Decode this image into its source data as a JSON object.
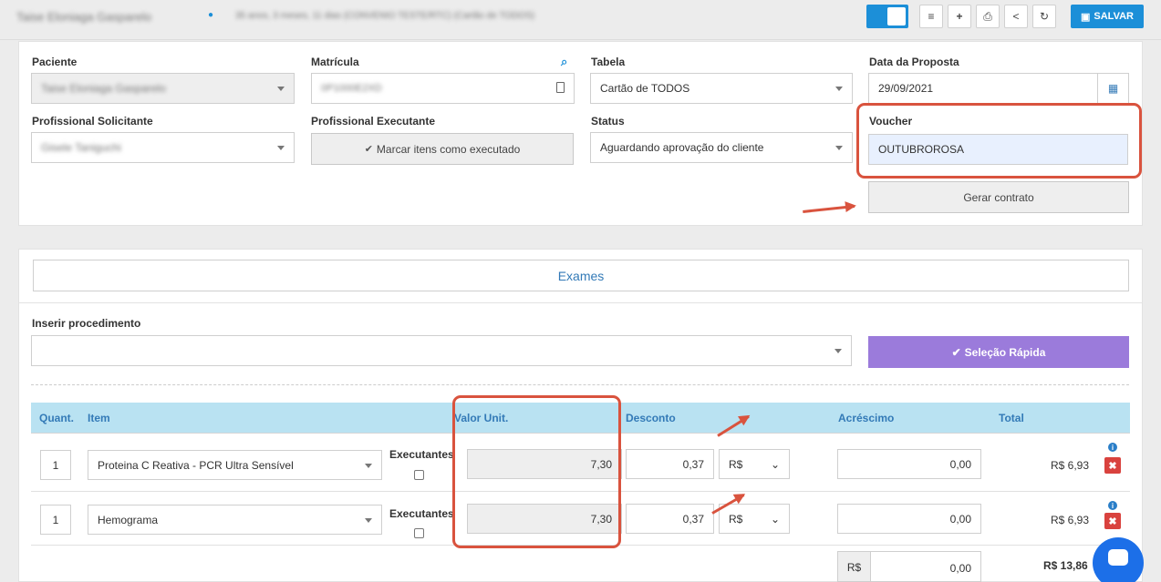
{
  "header": {
    "patient_name": "Taise Eloniaga Gasparelo",
    "patient_info": "35 anos, 3 meses, 11 dias (CONVENIO TESTE/RTC) (Cartão de TODOS)",
    "save_label": "SALVAR"
  },
  "form": {
    "patient_label": "Paciente",
    "patient_value": "Taise Eloniaga Gasparelo",
    "matricula_label": "Matrícula",
    "matricula_value": "0P1000E2XD",
    "tabela_label": "Tabela",
    "tabela_value": "Cartão de TODOS",
    "data_label": "Data da Proposta",
    "data_value": "29/09/2021",
    "solicitante_label": "Profissional Solicitante",
    "solicitante_value": "Gisele Taniguchi",
    "executante_label": "Profissional Executante",
    "marcar_label": "Marcar itens como executado",
    "status_label": "Status",
    "status_value": "Aguardando aprovação do cliente",
    "voucher_label": "Voucher",
    "voucher_value": "OUTUBROROSA",
    "gerar_label": "Gerar contrato"
  },
  "exames": {
    "tab_label": "Exames",
    "inserir_label": "Inserir procedimento",
    "selecao_label": "Seleção Rápida",
    "columns": [
      "Quant.",
      "Item",
      "Valor Unit.",
      "Desconto",
      "Acréscimo",
      "Total"
    ],
    "executantes_label": "Executantes",
    "rows": [
      {
        "qty": "1",
        "item": "Proteina C Reativa - PCR Ultra Sensível",
        "unit": "7,30",
        "desconto": "0,37",
        "currency": "R$",
        "acrescimo": "0,00",
        "total": "R$ 6,93"
      },
      {
        "qty": "1",
        "item": "Hemograma",
        "unit": "7,30",
        "desconto": "0,37",
        "currency": "R$",
        "acrescimo": "0,00",
        "total": "R$ 6,93"
      }
    ],
    "footer_currency": "R$",
    "footer_acrescimo": "0,00",
    "footer_total": "R$ 13,86"
  },
  "colors": {
    "accent": "#1c8fd8",
    "highlight": "#d9533e",
    "purple": "#9b7bdb"
  }
}
